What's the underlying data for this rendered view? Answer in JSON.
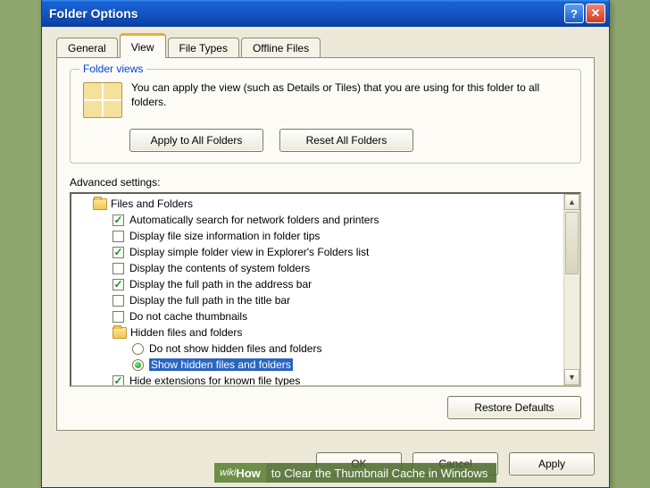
{
  "window": {
    "title": "Folder Options",
    "help_glyph": "?",
    "close_glyph": "✕"
  },
  "tabs": {
    "general": "General",
    "view": "View",
    "filetypes": "File Types",
    "offline": "Offline Files"
  },
  "folder_views": {
    "legend": "Folder views",
    "text": "You can apply the view (such as Details or Tiles) that you are using for this folder to all folders.",
    "apply_all": "Apply to All Folders",
    "reset_all": "Reset All Folders"
  },
  "advanced": {
    "label": "Advanced settings:",
    "root": "Files and Folders",
    "items": [
      {
        "kind": "check",
        "checked": true,
        "label": "Automatically search for network folders and printers"
      },
      {
        "kind": "check",
        "checked": false,
        "label": "Display file size information in folder tips"
      },
      {
        "kind": "check",
        "checked": true,
        "label": "Display simple folder view in Explorer's Folders list"
      },
      {
        "kind": "check",
        "checked": false,
        "label": "Display the contents of system folders"
      },
      {
        "kind": "check",
        "checked": true,
        "label": "Display the full path in the address bar"
      },
      {
        "kind": "check",
        "checked": false,
        "label": "Display the full path in the title bar"
      },
      {
        "kind": "check",
        "checked": false,
        "label": "Do not cache thumbnails"
      },
      {
        "kind": "group",
        "label": "Hidden files and folders"
      },
      {
        "kind": "radio",
        "checked": false,
        "label": "Do not show hidden files and folders"
      },
      {
        "kind": "radio",
        "checked": true,
        "selected": true,
        "label": "Show hidden files and folders"
      },
      {
        "kind": "check",
        "checked": true,
        "label": "Hide extensions for known file types"
      }
    ],
    "restore": "Restore Defaults"
  },
  "buttons": {
    "ok": "OK",
    "cancel": "Cancel",
    "apply": "Apply"
  },
  "overlay": {
    "wikihow_prefix": "wiki",
    "wikihow_suffix": "How",
    "caption": " to Clear the Thumbnail Cache in Windows"
  },
  "scroll": {
    "up": "▲",
    "down": "▼"
  }
}
